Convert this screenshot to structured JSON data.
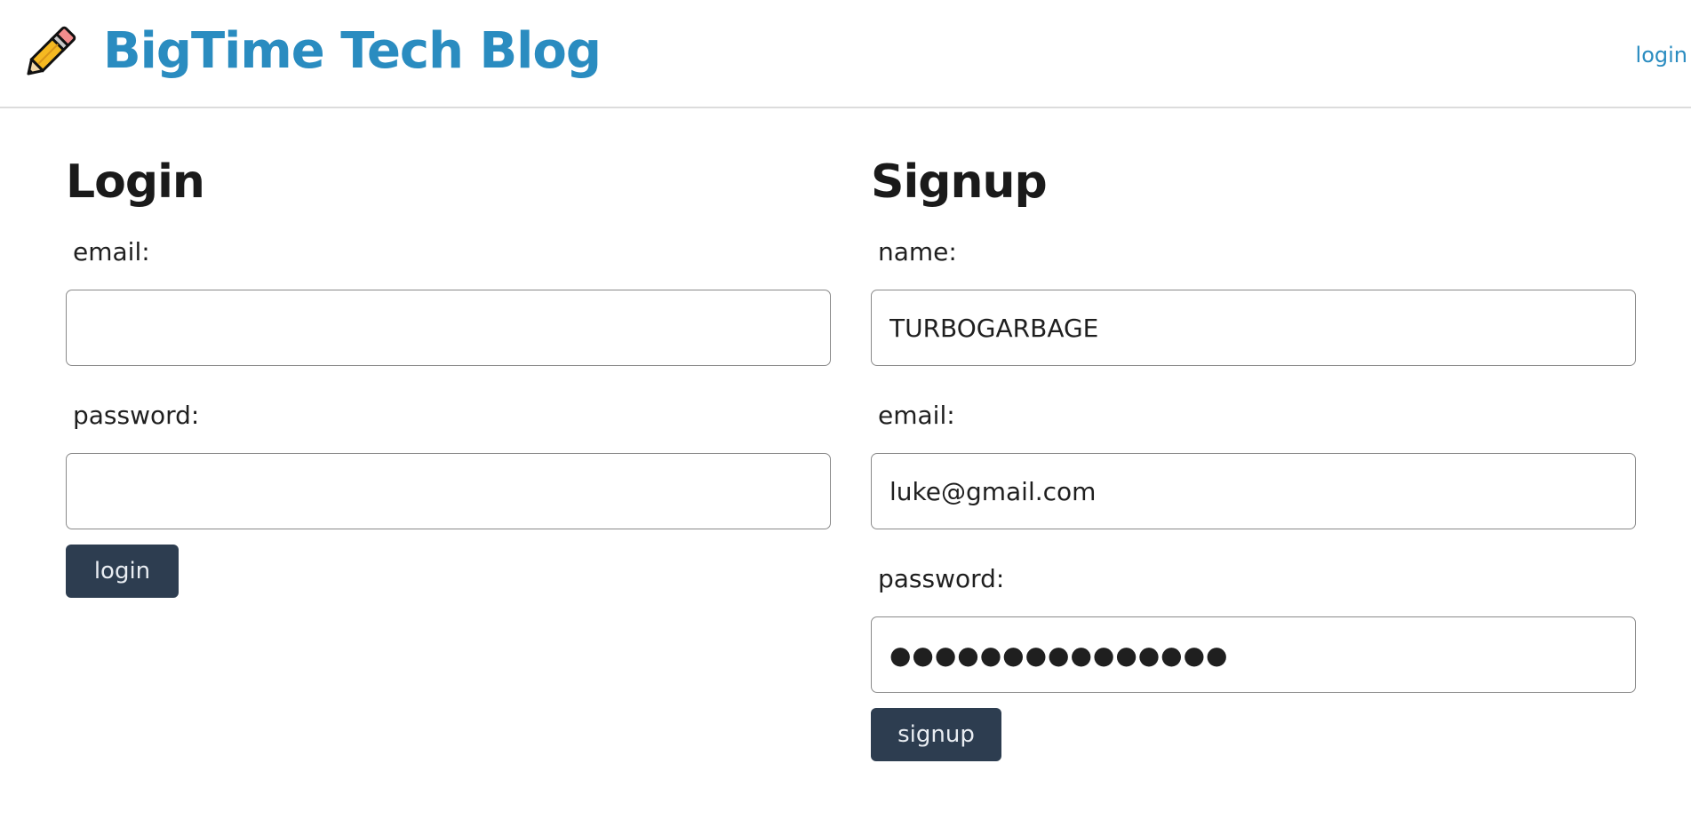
{
  "header": {
    "title": "BigTime Tech Blog",
    "logo_icon": "pencil-icon",
    "nav_login": "login",
    "accent_color": "#2a8cc0"
  },
  "login": {
    "heading": "Login",
    "email_label": "email:",
    "email_value": "",
    "password_label": "password:",
    "password_value": "",
    "button_label": "login"
  },
  "signup": {
    "heading": "Signup",
    "name_label": "name:",
    "name_value": "TURBOGARBAGE",
    "email_label": "email:",
    "email_value": "luke@gmail.com",
    "password_label": "password:",
    "password_value": "●●●●●●●●●●●●●●●",
    "button_label": "signup"
  },
  "colors": {
    "button_bg": "#2d3d50",
    "button_text": "#e9edf2"
  }
}
